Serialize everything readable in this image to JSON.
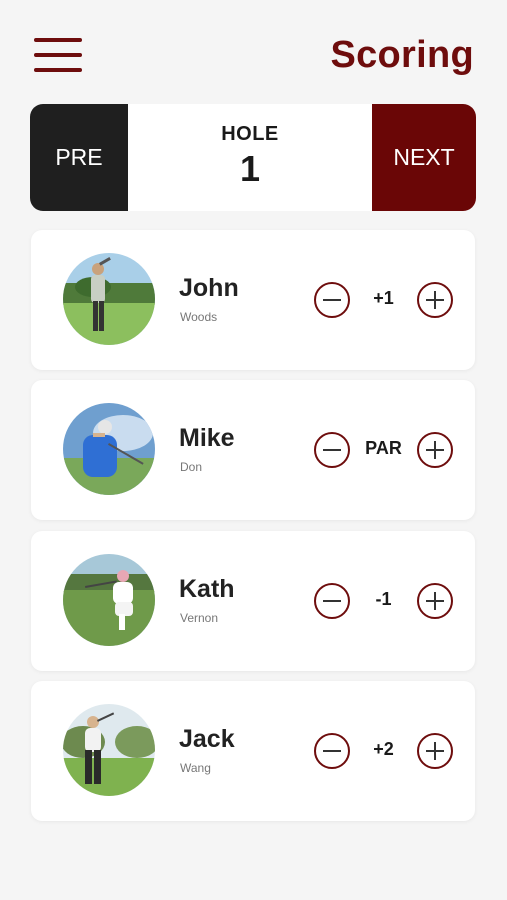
{
  "header": {
    "title": "Scoring",
    "menu_icon": "hamburger-menu-icon"
  },
  "hole_nav": {
    "prev_label": "PRE",
    "hole_label": "HOLE",
    "hole_number": "1",
    "next_label": "NEXT"
  },
  "players": [
    {
      "first_name": "John",
      "last_name": "Woods",
      "score": "+1"
    },
    {
      "first_name": "Mike",
      "last_name": "Don",
      "score": "PAR"
    },
    {
      "first_name": "Kath",
      "last_name": "Vernon",
      "score": "-1"
    },
    {
      "first_name": "Jack",
      "last_name": "Wang",
      "score": "+2"
    }
  ],
  "colors": {
    "accent": "#6e0d0d",
    "next_button": "#6a0606",
    "pre_button": "#1f1f1f",
    "background": "#f5f5f5"
  }
}
